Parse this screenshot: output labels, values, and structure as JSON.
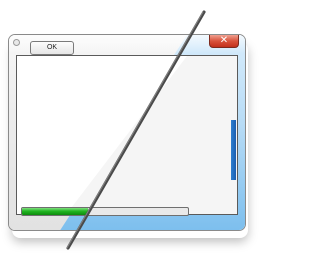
{
  "dialog": {
    "ok_label": "OK",
    "close_glyph": "✕",
    "progress": 0.4
  },
  "icons": {
    "system": "window-icon",
    "close": "close-icon",
    "overlay": "diagonal-line-icon"
  },
  "colors": {
    "close": "#d9533c",
    "progress": "#22b622",
    "glass": "#7dbfee",
    "scrollbar": "#2f7fd0"
  }
}
